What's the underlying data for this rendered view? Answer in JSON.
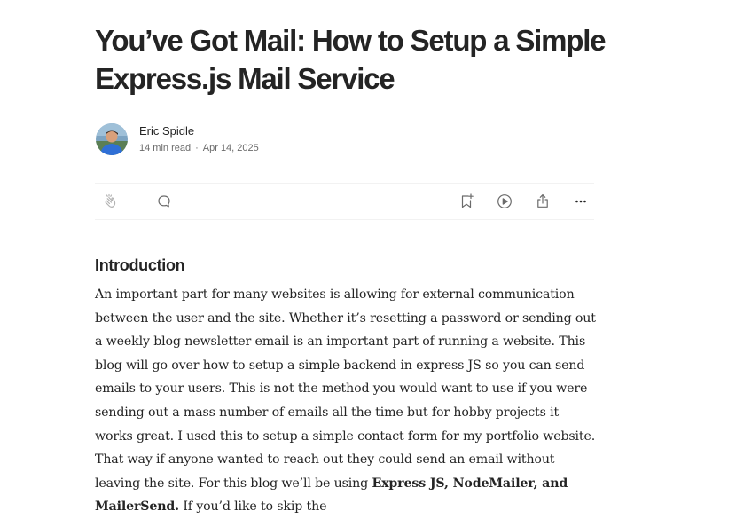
{
  "article": {
    "title": "You’ve Got Mail: How to Setup a Simple Express.js Mail Service",
    "author": "Eric Spidle",
    "read_time": "14 min read",
    "separator": "·",
    "date": "Apr 14, 2025",
    "section_heading": "Introduction",
    "paragraph": {
      "text_1": "An important part for many websites is allowing for external communication between the user and the site. Whether it’s resetting a password or sending out a weekly blog newsletter email is an important part of running a website. This blog will go over how to setup a simple backend in express JS so you can send emails to your users. This is not the method you would want to use if you were sending out a mass number of emails all the time but for hobby projects it works great. I used this to setup a simple contact form for my portfolio website. That way if anyone wanted to reach out they could send an email without leaving the site. For this blog we’ll be using ",
      "bold_1": "Express JS, NodeMailer, and MailerSend.",
      "text_2": " If you’d like to skip the"
    }
  },
  "action_bar": {
    "icons": {
      "clap": "clap-icon",
      "comment": "comment-icon",
      "save": "bookmark-add-icon",
      "listen": "play-circle-icon",
      "share": "share-icon",
      "more": "more-horizontal-icon"
    }
  },
  "colors": {
    "text": "#242424",
    "muted": "#6b6b6b",
    "icon": "#6b6b6b",
    "divider": "#f2f2f2",
    "avatar_bg": "#5f8fb0",
    "avatar_shirt": "#2f6fd6"
  }
}
